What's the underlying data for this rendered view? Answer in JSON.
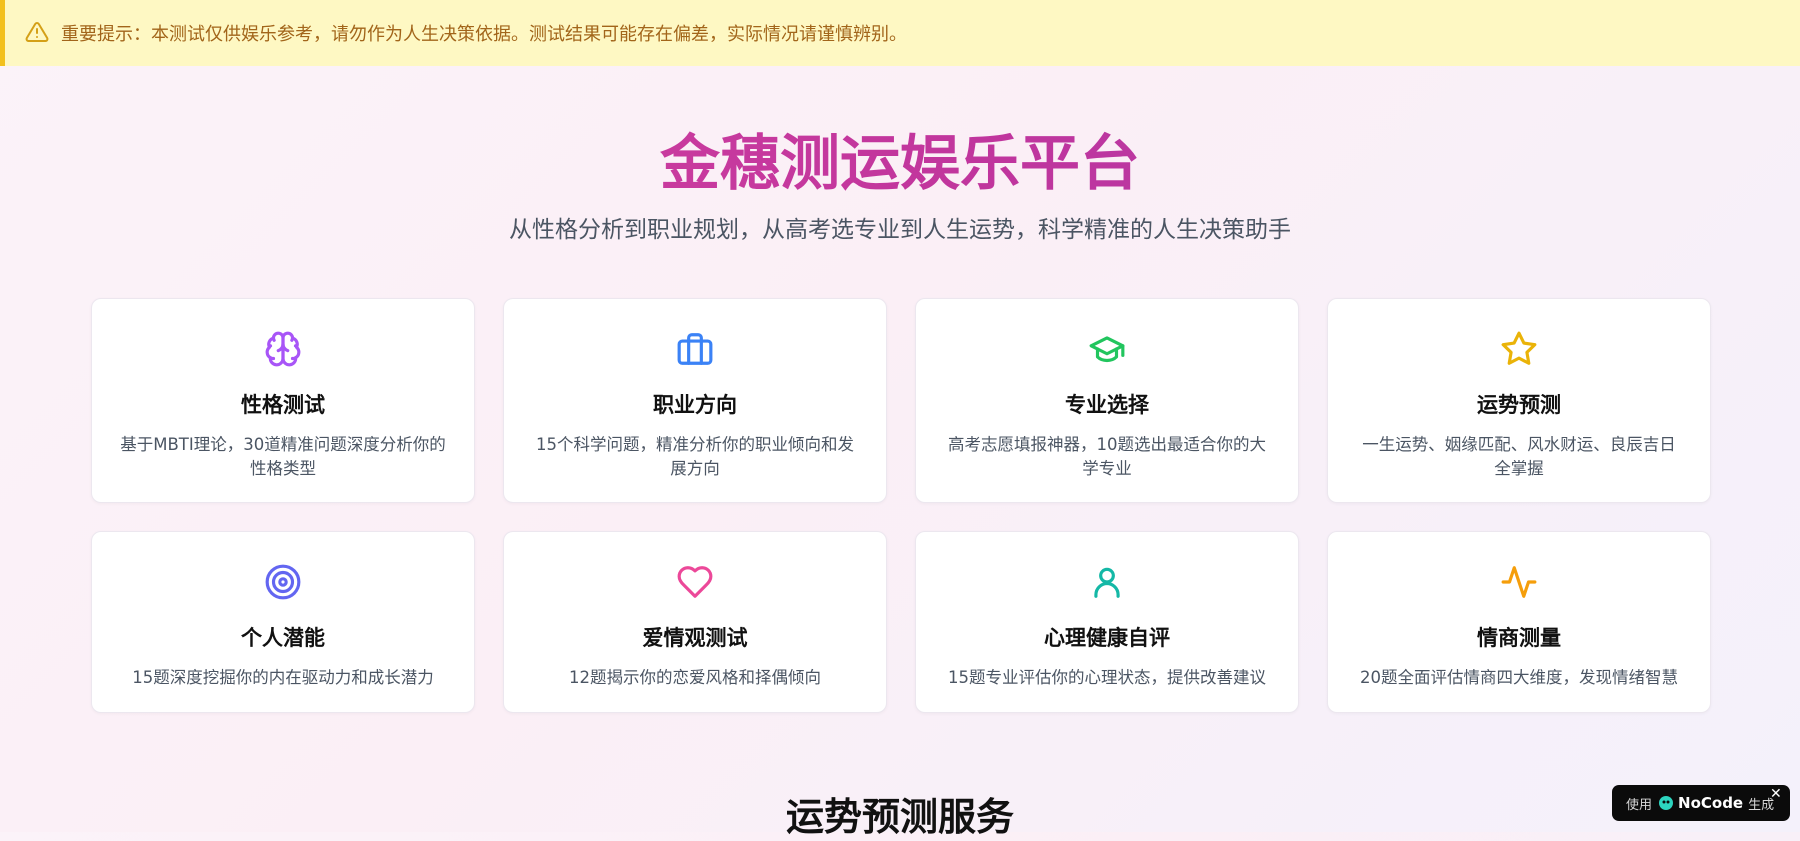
{
  "notice": {
    "icon": "warning-triangle-icon",
    "text": "重要提示：本测试仅供娱乐参考，请勿作为人生决策依据。测试结果可能存在偏差，实际情况请谨慎辨别。"
  },
  "hero": {
    "title": "金穗测运娱乐平台",
    "subtitle": "从性格分析到职业规划，从高考选专业到人生运势，科学精准的人生决策助手"
  },
  "cards": [
    {
      "icon": "brain-icon",
      "color": "#a855f7",
      "title": "性格测试",
      "desc": "基于MBTI理论，30道精准问题深度分析你的性格类型"
    },
    {
      "icon": "briefcase-icon",
      "color": "#3b82f6",
      "title": "职业方向",
      "desc": "15个科学问题，精准分析你的职业倾向和发展方向"
    },
    {
      "icon": "graduation-cap-icon",
      "color": "#22c55e",
      "title": "专业选择",
      "desc": "高考志愿填报神器，10题选出最适合你的大学专业"
    },
    {
      "icon": "star-icon",
      "color": "#eab308",
      "title": "运势预测",
      "desc": "一生运势、姻缘匹配、风水财运、良辰吉日全掌握"
    },
    {
      "icon": "target-icon",
      "color": "#6366f1",
      "title": "个人潜能",
      "desc": "15题深度挖掘你的内在驱动力和成长潜力"
    },
    {
      "icon": "heart-icon",
      "color": "#ec4899",
      "title": "爱情观测试",
      "desc": "12题揭示你的恋爱风格和择偶倾向"
    },
    {
      "icon": "user-icon",
      "color": "#14b8a6",
      "title": "心理健康自评",
      "desc": "15题专业评估你的心理状态，提供改善建议"
    },
    {
      "icon": "activity-icon",
      "color": "#f59e0b",
      "title": "情商测量",
      "desc": "20题全面评估情商四大维度，发现情绪智慧"
    }
  ],
  "section": {
    "title": "运势预测服务"
  },
  "badge": {
    "prefix": "使用",
    "brand": "NoCode",
    "suffix": "生成",
    "close": "✕"
  }
}
